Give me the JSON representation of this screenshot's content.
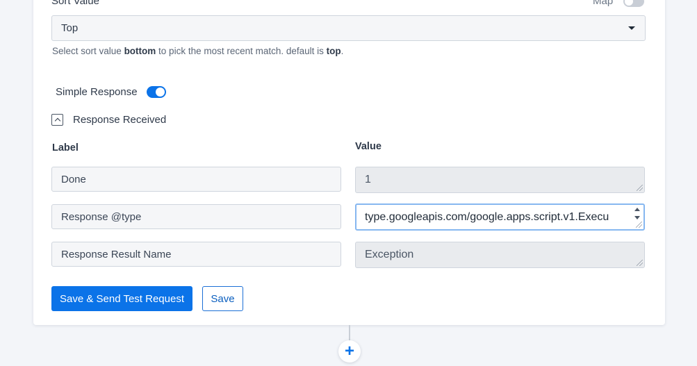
{
  "sort": {
    "label": "Sort Value",
    "map_label": "Map",
    "selected": "Top",
    "hint_pre": "Select sort value ",
    "hint_bold1": "bottom",
    "hint_mid": " to pick the most recent match. default is ",
    "hint_bold2": "top",
    "hint_post": "."
  },
  "simple_response": {
    "label": "Simple Response",
    "enabled": true
  },
  "response_received": {
    "label": "Response Received"
  },
  "table": {
    "label_header": "Label",
    "value_header": "Value",
    "rows": [
      {
        "label": "Done",
        "value": "1"
      },
      {
        "label": "Response @type",
        "value": "type.googleapis.com/google.apps.script.v1.Execu"
      },
      {
        "label": "Response Result Name",
        "value": "Exception"
      }
    ]
  },
  "actions": {
    "save_send_label": "Save & Send Test Request",
    "save_label": "Save"
  },
  "add_step": {
    "symbol": "+"
  },
  "colors": {
    "accent": "#0b73e8",
    "background": "#f3f5f9",
    "card": "#ffffff"
  }
}
